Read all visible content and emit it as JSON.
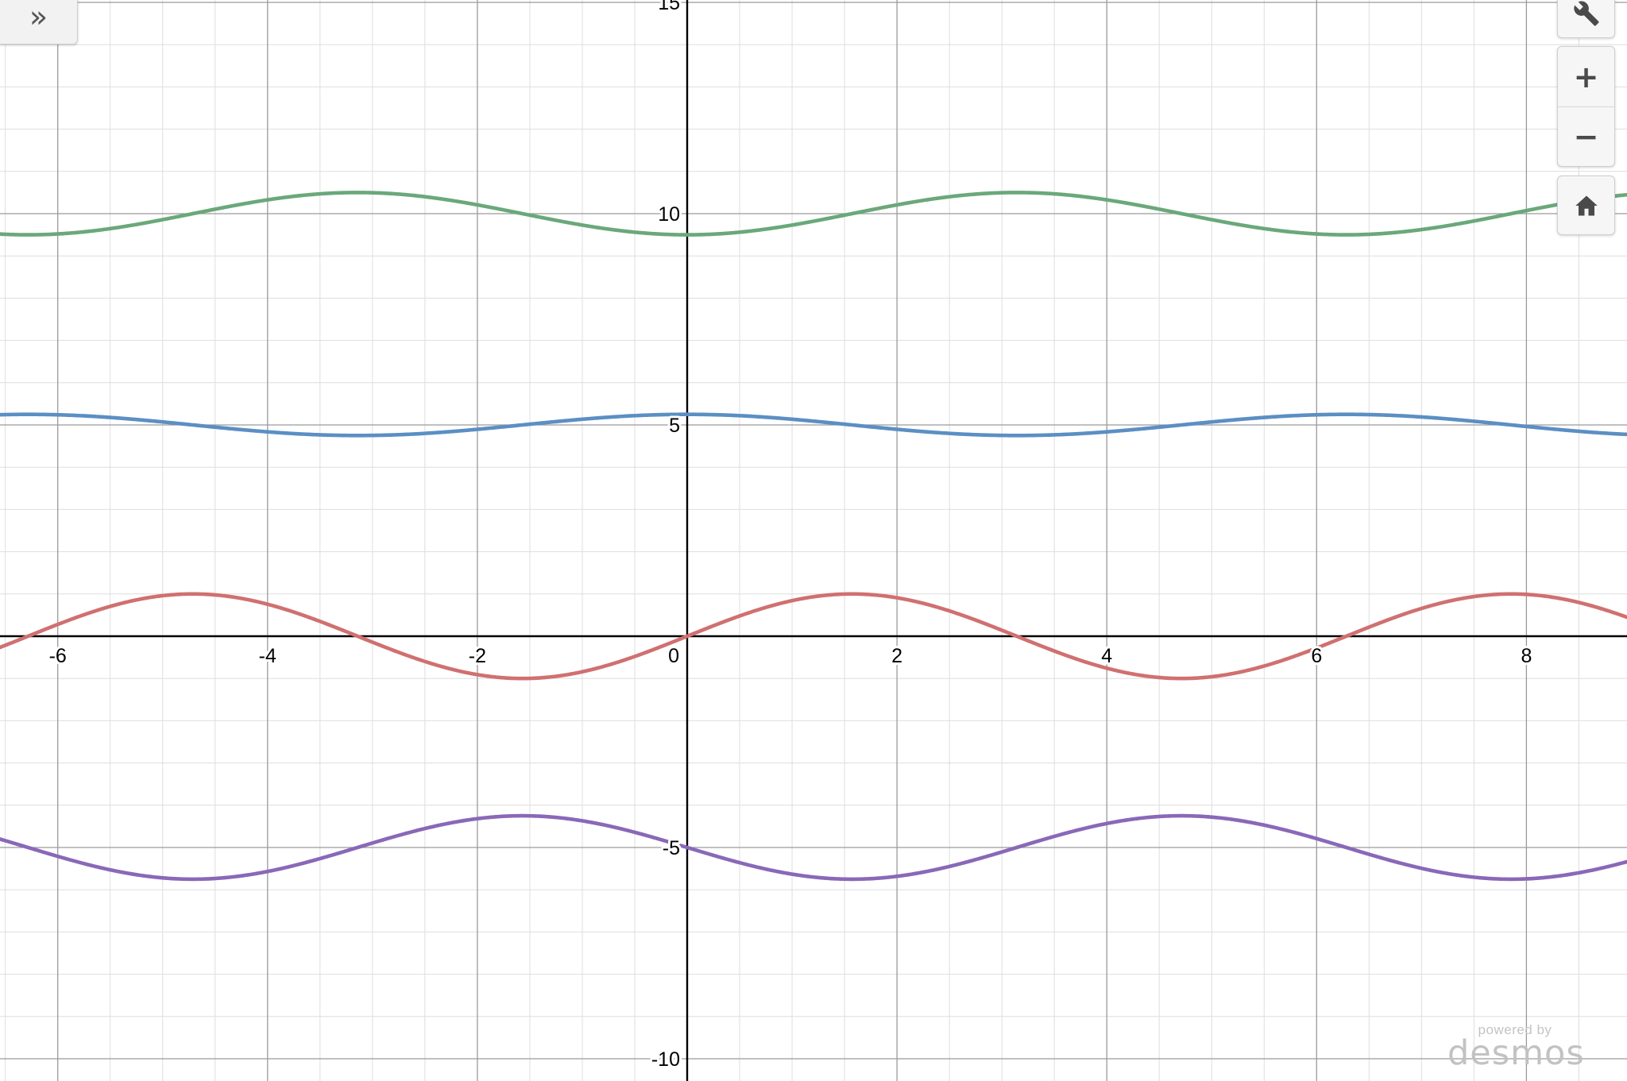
{
  "graph": {
    "x_ticks": [
      "-6",
      "-4",
      "-2",
      "0",
      "2",
      "4",
      "6",
      "8"
    ],
    "y_ticks": [
      "15",
      "10",
      "5",
      "-5",
      "-10"
    ],
    "curves": [
      {
        "name": "green-curve",
        "color": "#6aa87a",
        "offset": 10,
        "amplitude": -0.5,
        "kind": "cos"
      },
      {
        "name": "blue-curve",
        "color": "#5b8fc4",
        "offset": 5,
        "amplitude": 0.25,
        "kind": "cos"
      },
      {
        "name": "red-curve",
        "color": "#d07070",
        "offset": 0,
        "amplitude": 1,
        "kind": "sin"
      },
      {
        "name": "purple-curve",
        "color": "#8a68b8",
        "offset": -5,
        "amplitude": -0.75,
        "kind": "sin"
      }
    ]
  },
  "controls": {
    "expand_icon": "double-chevron-right-icon",
    "settings_icon": "wrench-icon",
    "zoom_in_icon": "plus-icon",
    "zoom_out_icon": "minus-icon",
    "home_icon": "home-icon"
  },
  "watermark": {
    "powered": "powered by",
    "brand": "desmos"
  }
}
